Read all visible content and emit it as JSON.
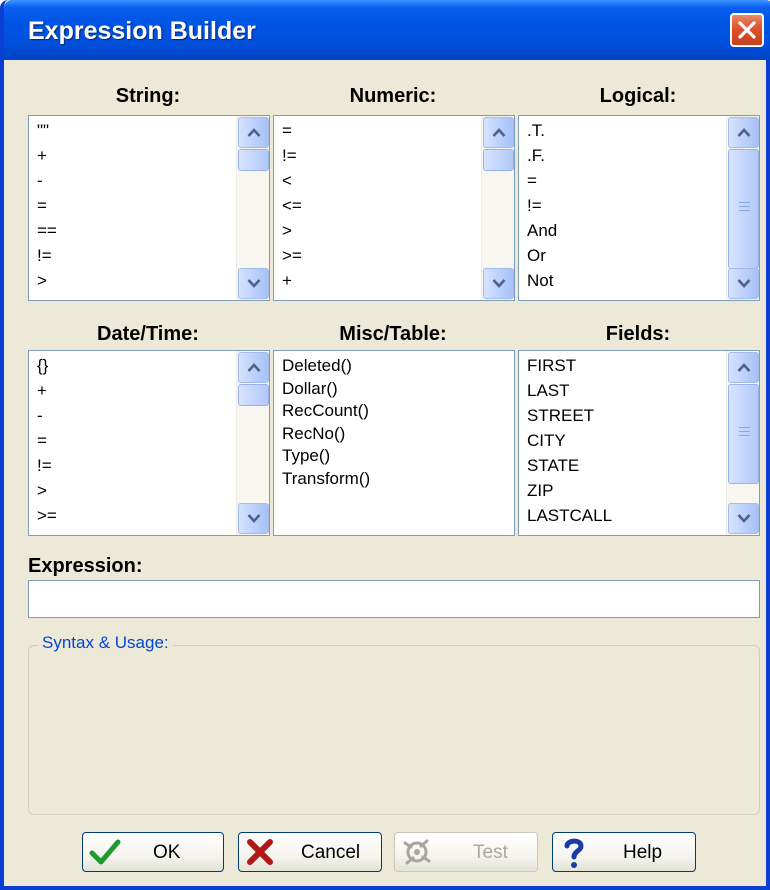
{
  "window": {
    "title": "Expression Builder"
  },
  "sections": {
    "string": {
      "label": "String:",
      "items": [
        "\"\"",
        "+",
        "-",
        "=",
        "==",
        "!=",
        ">"
      ]
    },
    "numeric": {
      "label": "Numeric:",
      "items": [
        "=",
        "!=",
        "<",
        "<=",
        ">",
        ">=",
        "+"
      ]
    },
    "logical": {
      "label": "Logical:",
      "items": [
        ".T.",
        ".F.",
        "=",
        "!=",
        "And",
        "Or",
        "Not"
      ]
    },
    "datetime": {
      "label": "Date/Time:",
      "items": [
        "{}",
        "+",
        "-",
        "=",
        "!=",
        ">",
        ">="
      ]
    },
    "misc": {
      "label": "Misc/Table:",
      "items": [
        "Deleted()",
        "Dollar()",
        "RecCount()",
        "RecNo()",
        "Type()",
        "Transform()"
      ]
    },
    "fields": {
      "label": "Fields:",
      "items": [
        "FIRST",
        "LAST",
        "STREET",
        "CITY",
        "STATE",
        "ZIP",
        "LASTCALL"
      ]
    }
  },
  "expression": {
    "label": "Expression:",
    "value": ""
  },
  "syntax": {
    "label": "Syntax & Usage:"
  },
  "buttons": {
    "ok": "OK",
    "cancel": "Cancel",
    "test": "Test",
    "help": "Help"
  },
  "colors": {
    "title_bar": "#0054e3",
    "dialog_bg": "#ece9d8",
    "legend_text": "#0046d5"
  },
  "icons": {
    "ok": "check-icon",
    "cancel": "x-icon",
    "test": "test-icon",
    "help": "help-icon",
    "close": "close-icon"
  }
}
